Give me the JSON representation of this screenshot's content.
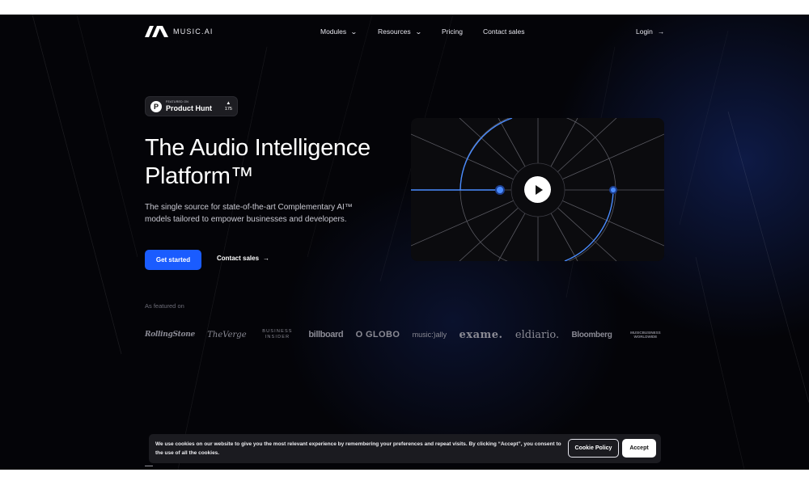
{
  "nav": {
    "logo_text": "MUSIC.AI",
    "items": [
      {
        "label": "Modules",
        "has_dropdown": true
      },
      {
        "label": "Resources",
        "has_dropdown": true
      },
      {
        "label": "Pricing",
        "has_dropdown": false
      },
      {
        "label": "Contact sales",
        "has_dropdown": false
      }
    ],
    "login_label": "Login",
    "login_icon": "arrow-right-icon"
  },
  "badge": {
    "small_text": "FEATURED ON",
    "name": "Product Hunt",
    "logo_letter": "P",
    "upvote_icon": "triangle-up-icon",
    "votes": "175"
  },
  "hero": {
    "headline_line1": "The Audio Intelligence",
    "headline_line2": "Platform™",
    "subtext": "The single source for state-of-the-art Complementary AI™ models tailored to empower businesses and developers.",
    "primary_cta": "Get started",
    "secondary_cta": "Contact sales",
    "secondary_icon": "arrow-right-icon"
  },
  "video": {
    "play_icon": "play-icon",
    "accent_color": "#4a8cff"
  },
  "featured": {
    "label": "As featured on",
    "logos": [
      "RollingStone",
      "TheVerge",
      "BUSINESS INSIDER",
      "billboard",
      "O GLOBO",
      "music:)ally",
      "exame.",
      "eldiario.",
      "Bloomberg",
      "MUSICBUSINESS WORLDWIDE"
    ]
  },
  "cookie": {
    "text": "We use cookies on our website to give you the most relevant experience by remembering your preferences and repeat visits. By clicking “Accept”, you consent to the use of all the cookies.",
    "policy_label": "Cookie Policy",
    "accept_label": "Accept"
  },
  "colors": {
    "background": "#040408",
    "primary_button": "#1a5cff",
    "glow": "#162c78"
  }
}
